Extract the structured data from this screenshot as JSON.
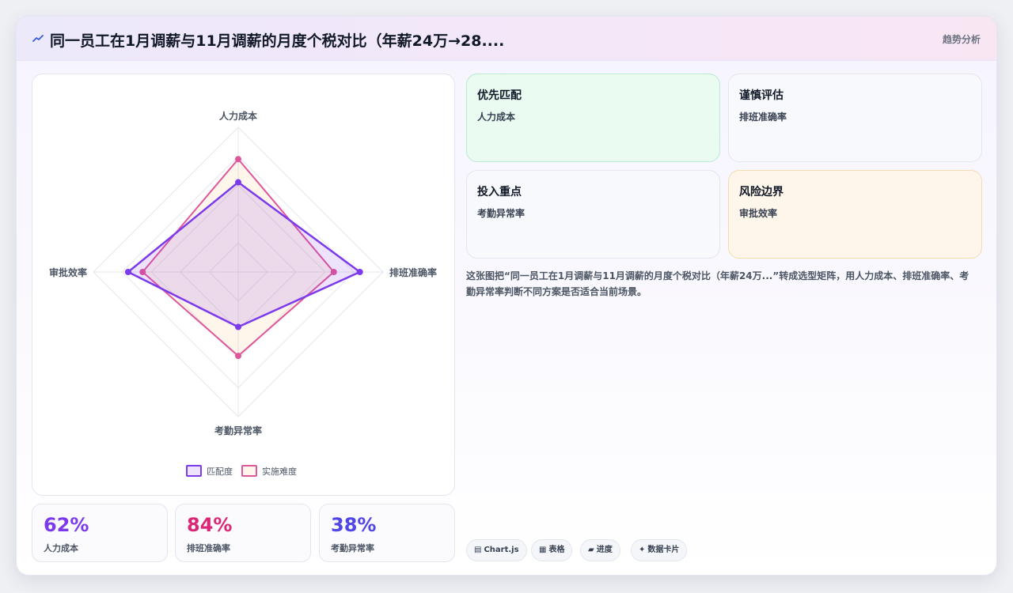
{
  "header": {
    "icon": "trend-line-icon",
    "title": "同一员工在1月调薪与11月调薪的月度个税对比（年薪24万→28....",
    "tag": "趋势分析"
  },
  "chart_data": {
    "type": "radar",
    "axes": [
      "人力成本",
      "排班准确率",
      "考勤异常率",
      "审批效率"
    ],
    "range": [
      0,
      100
    ],
    "grid_levels": 5,
    "series": [
      {
        "name": "匹配度",
        "values": [
          62,
          84,
          38,
          76
        ],
        "color": "#7c3aed",
        "fill": "rgba(124,58,237,0.14)"
      },
      {
        "name": "实施难度",
        "values": [
          78,
          66,
          58,
          66
        ],
        "color": "#e0569b",
        "fill": "rgba(248,170,90,0.12)"
      }
    ],
    "legend_position": "bottom"
  },
  "stats": [
    {
      "value": "62%",
      "label": "人力成本",
      "color": "#7c3aed"
    },
    {
      "value": "84%",
      "label": "排班准确率",
      "color": "#db2777"
    },
    {
      "value": "38%",
      "label": "考勤异常率",
      "color": "#4f46e5"
    }
  ],
  "quadrants": [
    {
      "title": "优先匹配",
      "value": "人力成本",
      "bg": "#eafbf2",
      "border": "#b7ecd0"
    },
    {
      "title": "谨慎评估",
      "value": "排班准确率",
      "bg": "#f8f9fd",
      "border": "#e3e6ee"
    },
    {
      "title": "投入重点",
      "value": "考勤异常率",
      "bg": "#f8f9fd",
      "border": "#e3e6ee"
    },
    {
      "title": "风险边界",
      "value": "审批效率",
      "bg": "#fef6ea",
      "border": "#f3dcb0"
    }
  ],
  "description": "这张图把“同一员工在1月调薪与11月调薪的月度个税对比（年薪24万...”转成选型矩阵，用人力成本、排班准确率、考勤异常率判断不同方案是否适合当前场景。",
  "chips": [
    {
      "icon": "▤",
      "label": "Chart.js"
    },
    {
      "icon": "▦",
      "label": "表格"
    },
    {
      "icon": "▰",
      "label": "进度"
    },
    {
      "icon": "✦",
      "label": "数据卡片"
    }
  ]
}
